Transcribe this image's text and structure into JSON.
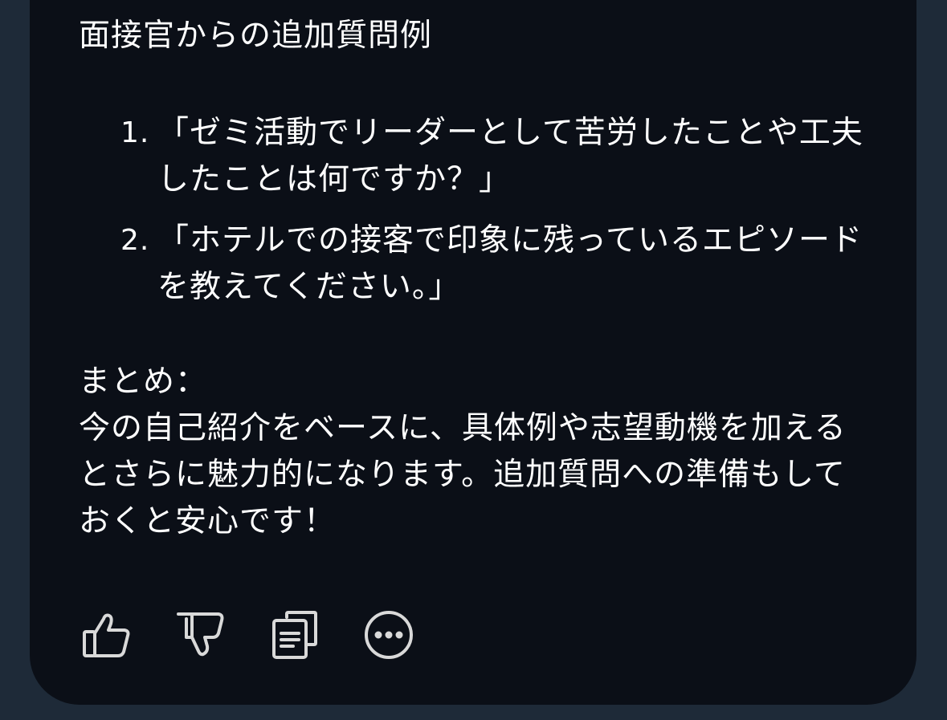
{
  "message": {
    "heading": "面接官からの追加質問例",
    "questions": [
      {
        "number": "1.",
        "text": "「ゼミ活動でリーダーとして苦労したことや工夫したことは何ですか？」"
      },
      {
        "number": "2.",
        "text": "「ホテルでの接客で印象に残っているエピソードを教えてください。」"
      }
    ],
    "summary_label": "まとめ：",
    "summary_text": "今の自己紹介をベースに、具体例や志望動機を加えるとさらに魅力的になります。追加質問への準備もしておくと安心です！"
  },
  "actions": [
    {
      "icon": "thumbs-up-icon"
    },
    {
      "icon": "thumbs-down-icon"
    },
    {
      "icon": "copy-icon"
    },
    {
      "icon": "more-icon"
    }
  ],
  "colors": {
    "page_background": "#1e2a38",
    "card_background": "#0b0f17",
    "text": "#ffffff",
    "icon": "#d9d9d9"
  }
}
